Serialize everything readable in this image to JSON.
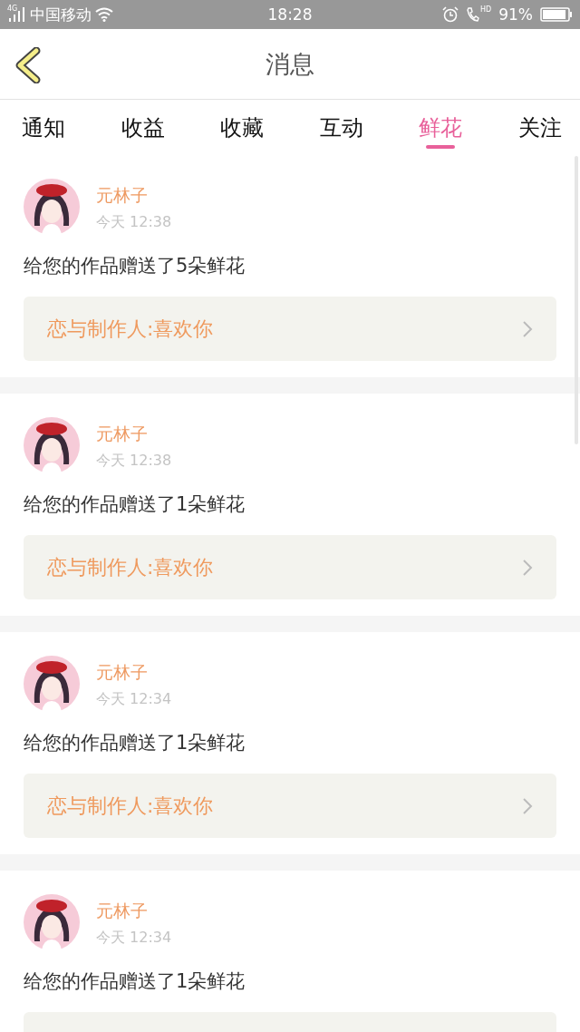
{
  "status_bar": {
    "network": "4G",
    "carrier": "中国移动",
    "time": "18:28",
    "call": "HD",
    "battery": "91%"
  },
  "header": {
    "title": "消息"
  },
  "tabs": [
    {
      "label": "通知",
      "selected": false
    },
    {
      "label": "收益",
      "selected": false
    },
    {
      "label": "收藏",
      "selected": false
    },
    {
      "label": "互动",
      "selected": false
    },
    {
      "label": "鲜花",
      "selected": true
    },
    {
      "label": "关注",
      "selected": false
    }
  ],
  "messages": [
    {
      "name": "元林子",
      "time": "今天 12:38",
      "text": "给您的作品赠送了5朵鲜花",
      "link": "恋与制作人:喜欢你"
    },
    {
      "name": "元林子",
      "time": "今天 12:38",
      "text": "给您的作品赠送了1朵鲜花",
      "link": "恋与制作人:喜欢你"
    },
    {
      "name": "元林子",
      "time": "今天 12:34",
      "text": "给您的作品赠送了1朵鲜花",
      "link": "恋与制作人:喜欢你"
    },
    {
      "name": "元林子",
      "time": "今天 12:34",
      "text": "给您的作品赠送了1朵鲜花"
    }
  ]
}
